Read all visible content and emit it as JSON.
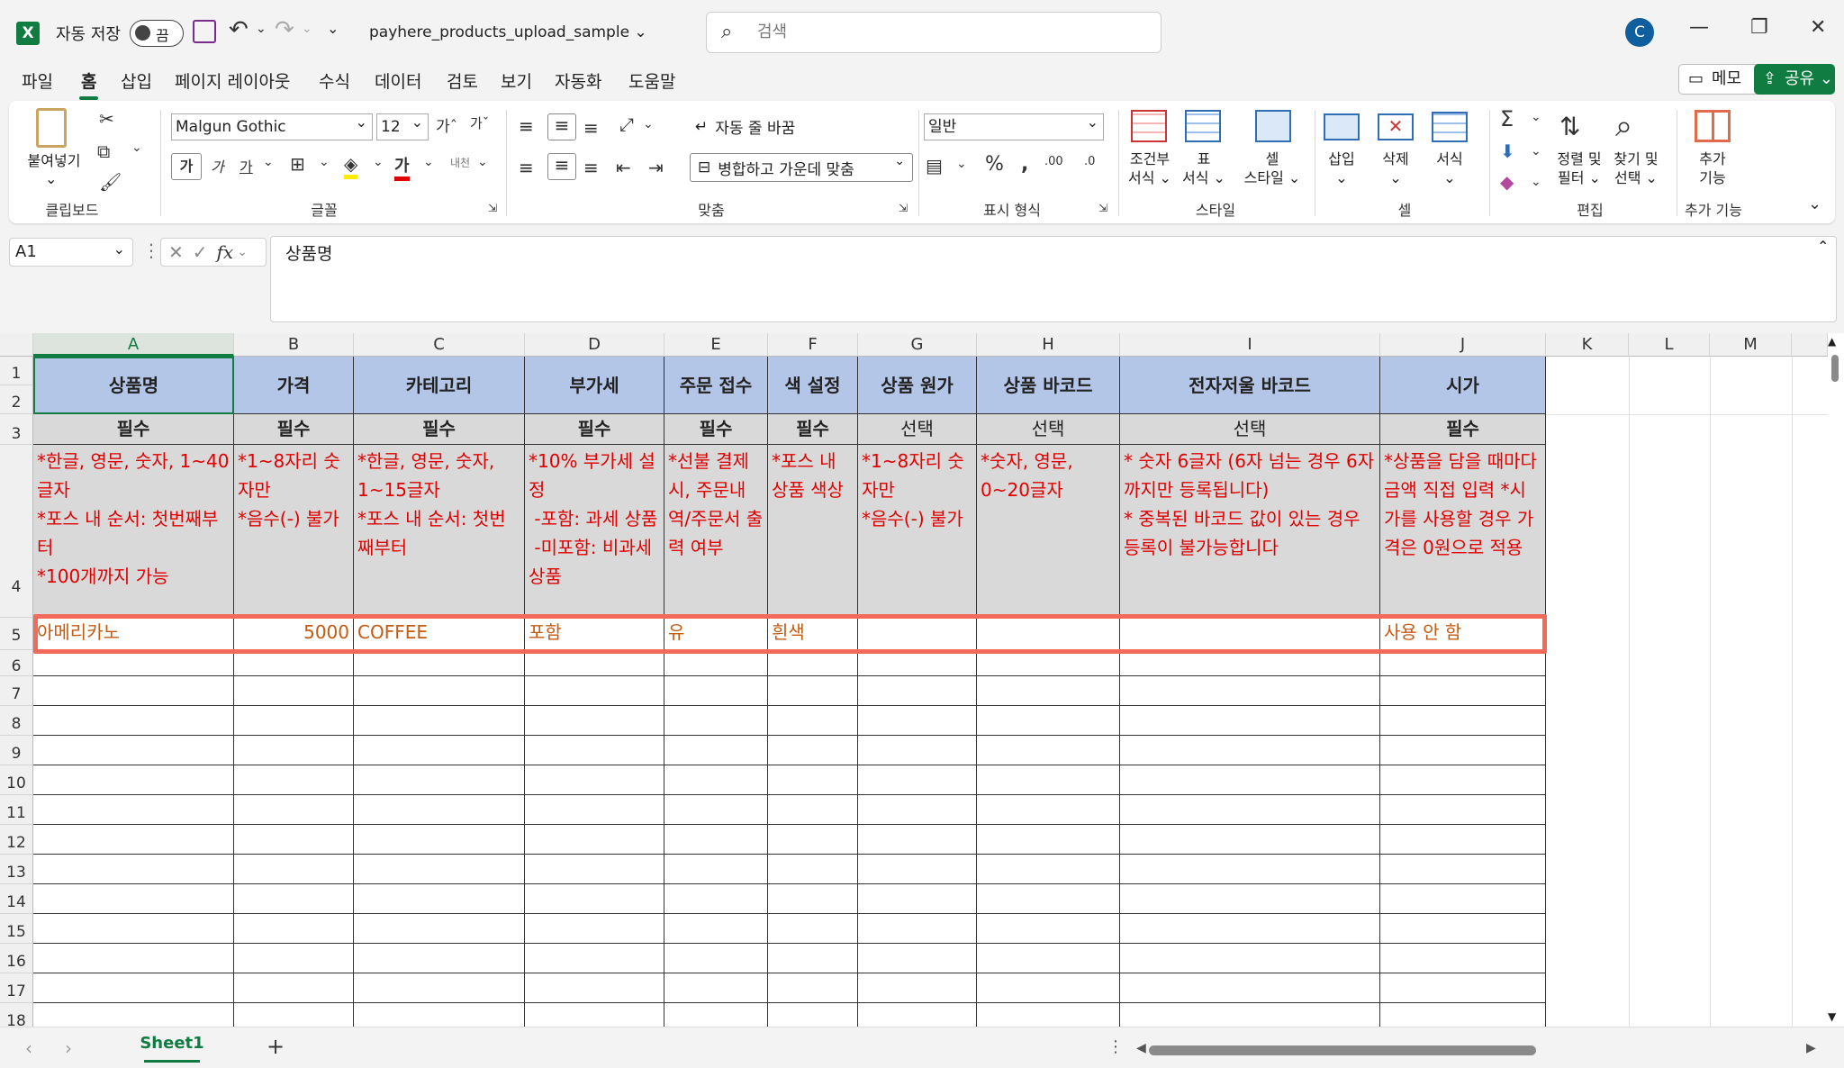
{
  "titlebar": {
    "app_icon": "X",
    "autosave_label": "자동 저장",
    "autosave_state": "끔",
    "filename": "payhere_products_upload_sample",
    "search_placeholder": "검색",
    "user_initial": "C"
  },
  "menu": [
    "파일",
    "홈",
    "삽입",
    "페이지 레이아웃",
    "수식",
    "데이터",
    "검토",
    "보기",
    "자동화",
    "도움말"
  ],
  "actions": {
    "memo": "메모",
    "share": "공유"
  },
  "ribbon": {
    "clipboard": {
      "paste": "붙여넣기",
      "group": "클립보드"
    },
    "font": {
      "name": "Malgun Gothic",
      "size": "12",
      "group": "글꼴"
    },
    "align": {
      "wrap": "자동 줄 바꿈",
      "merge": "병합하고 가운데 맞춤",
      "group": "맞춤"
    },
    "number": {
      "format": "일반",
      "group": "표시 형식"
    },
    "styles": {
      "cond": [
        "조건부",
        "서식"
      ],
      "table": [
        "표",
        "서식"
      ],
      "cell": [
        "셀",
        "스타일"
      ],
      "group": "스타일"
    },
    "cells": {
      "insert": "삽입",
      "delete": "삭제",
      "format": "서식",
      "group": "셀"
    },
    "edit": {
      "sort": [
        "정렬 및",
        "필터"
      ],
      "find": [
        "찾기 및",
        "선택"
      ],
      "group": "편집"
    },
    "addins": {
      "label": [
        "추가",
        "기능"
      ],
      "group": "추가 기능"
    }
  },
  "formula_bar": {
    "name_box": "A1",
    "fx": "fx",
    "content": "상품명"
  },
  "sheet": {
    "columns": [
      "A",
      "B",
      "C",
      "D",
      "E",
      "F",
      "G",
      "H",
      "I",
      "J",
      "K",
      "L",
      "M"
    ],
    "rows": [
      "1",
      "2",
      "3",
      "4",
      "5",
      "6",
      "7",
      "8",
      "9",
      "10",
      "11",
      "12",
      "13",
      "14",
      "15",
      "16",
      "17",
      "18"
    ],
    "headers": [
      "상품명",
      "가격",
      "카테고리",
      "부가세",
      "주문 접수",
      "색 설정",
      "상품 원가",
      "상품 바코드",
      "전자저울 바코드",
      "시가"
    ],
    "requirement": [
      "필수",
      "필수",
      "필수",
      "필수",
      "필수",
      "필수",
      "선택",
      "선택",
      "선택",
      "필수"
    ],
    "notes": [
      "*한글, 영문, 숫자, 1~40글자\n*포스 내 순서: 첫번째부터\n*100개까지 가능",
      "*1~8자리 숫자만\n*음수(-) 불가",
      "*한글, 영문, 숫자, 1~15글자\n*포스 내 순서: 첫번째부터",
      "*10% 부가세 설정\n -포함: 과세 상품\n -미포함: 비과세 상품",
      "*선불 결제 시, 주문내역/주문서 출력 여부",
      "*포스 내 상품 색상",
      "*1~8자리 숫자만\n*음수(-) 불가",
      "*숫자, 영문, 0~20글자",
      "* 숫자 6글자 (6자 넘는 경우 6자까지만 등록됩니다)\n* 중복된 바코드 값이 있는 경우 등록이 불가능합니다",
      "*상품을 담을 때마다 금액 직접 입력 *시가를 사용할 경우 가격은 0원으로 적용"
    ],
    "row5": [
      "아메리카노",
      "5000",
      "COFFEE",
      "포함",
      "유",
      "흰색",
      "",
      "",
      "",
      "사용 안 함"
    ]
  },
  "status": {
    "sheet_tab": "Sheet1",
    "add_sheet": "+"
  }
}
